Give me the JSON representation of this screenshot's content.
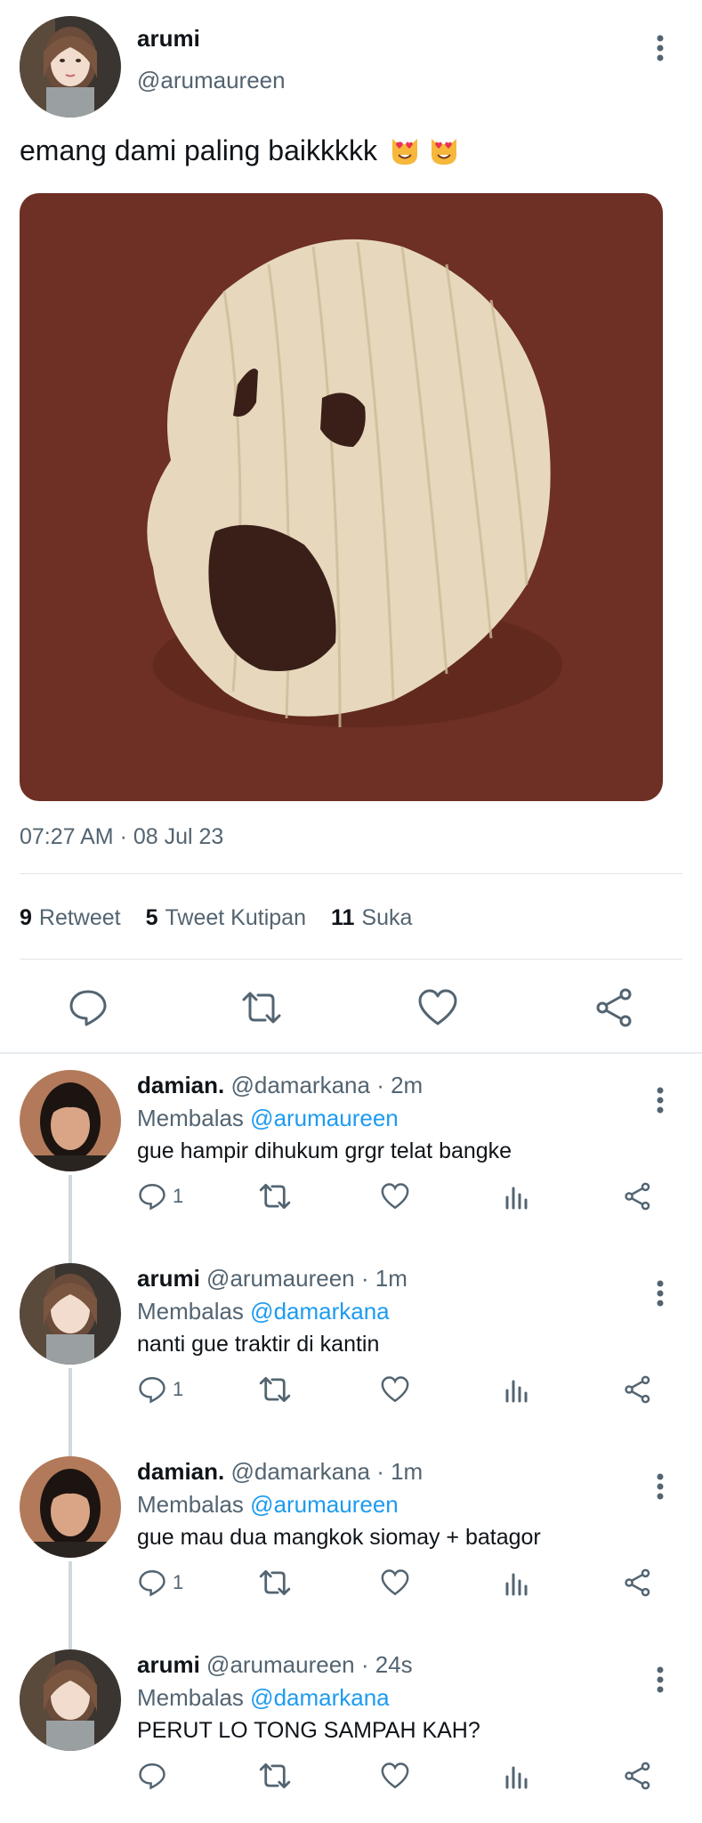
{
  "main_tweet": {
    "name": "arumi",
    "handle": "@arumaureen",
    "text": "emang dami paling baikkkkk",
    "emojis": [
      "smiling-cat-heart-eyes",
      "smiling-cat-heart-eyes"
    ],
    "timestamp": "07:27 AM · 08 Jul 23",
    "stats": {
      "retweets_count": "9",
      "retweets_label": "Retweet",
      "quotes_count": "5",
      "quotes_label": "Tweet Kutipan",
      "likes_count": "11",
      "likes_label": "Suka"
    },
    "media_description_colors": {
      "background": "#6e2f25",
      "shell": "#e7d8bd"
    }
  },
  "replies": [
    {
      "name": "damian.",
      "handle": "@damarkana",
      "time": "· 2m",
      "replying_label": "Membalas",
      "replying_to": "@arumaureen",
      "text": "gue hampir dihukum grgr telat bangke",
      "reply_count": "1",
      "avatar": "damian"
    },
    {
      "name": "arumi",
      "handle": "@arumaureen",
      "time": "· 1m",
      "replying_label": "Membalas",
      "replying_to": "@damarkana",
      "text": "nanti gue traktir di kantin",
      "reply_count": "1",
      "avatar": "arumi"
    },
    {
      "name": "damian.",
      "handle": "@damarkana",
      "time": "· 1m",
      "replying_label": "Membalas",
      "replying_to": "@arumaureen",
      "text": "gue mau dua mangkok siomay + batagor",
      "reply_count": "1",
      "avatar": "damian"
    },
    {
      "name": "arumi",
      "handle": "@arumaureen",
      "time": "· 24s",
      "replying_label": "Membalas",
      "replying_to": "@damarkana",
      "text": "PERUT LO TONG SAMPAH KAH?",
      "reply_count": "",
      "avatar": "arumi"
    }
  ],
  "colors": {
    "accent": "#1d9bf0",
    "secondary_text": "#536471",
    "primary_text": "#0f1419"
  }
}
